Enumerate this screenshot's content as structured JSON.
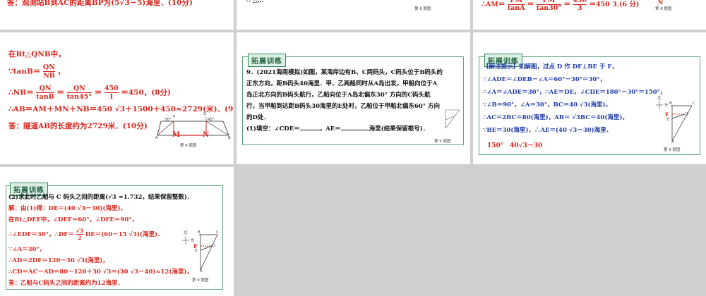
{
  "slide1": {
    "answer": "答：观测站B到AC的距离BP为(5√3－5)海里．(10分)"
  },
  "slide2": {
    "top_text": "∴ △…",
    "caption": "第 8 题图"
  },
  "slide3": {
    "formula": "∴AM＝PM/tanA＝PM/tan30°＝45√3/3＝450√3.(6 分)",
    "formula_left": "∴AM＝",
    "frac1_num": "PM",
    "frac1_den": "tanA",
    "eq": "＝",
    "frac2_num": "PM",
    "frac2_den": "tan30°",
    "frac3_num": "450",
    "frac3_den": "3",
    "formula_right": "＝450 3.(6 分)",
    "caption": "第 8 题图"
  },
  "slide4": {
    "l1": "在Rt△QNB中，",
    "l2_a": "∵tanB＝",
    "l2_num": "QN",
    "l2_den": "NB",
    "l2_b": "，",
    "l3_a": "∴NB＝",
    "l3_f1n": "QN",
    "l3_f1d": "tanB",
    "l3_eq": "＝",
    "l3_f2n": "QN",
    "l3_f2d": "tan45°",
    "l3_eq2": "＝",
    "l3_f3n": "450",
    "l3_f3d": "1",
    "l3_b": "＝450，(8分)",
    "l4": "∴AB＝AM＋MN＋NB＝450 √3＋1500＋450≈2729(米)．(9分)",
    "l5": "答：隧道AB的长度约为2729米．(10分)",
    "fig_labels": [
      "30°",
      "P",
      "Q",
      "45°",
      "A",
      "M",
      "N",
      "B"
    ],
    "caption": "第 8 题图"
  },
  "slide5": {
    "tag": "拓展训练",
    "l1": "9．(2021海南模拟)如图，某海岸边有B、C两码头，C码头位于B码头的",
    "l2": "正东方向，距B码头40海里．甲、乙两船同时从A岛出发，甲船向位于A",
    "l3": "岛正北方向的B码头航行，乙船向位于A岛北偏东30° 方向的C码头航",
    "l4": "行，当甲船到达距B码头30海里的E处时，乙船位于甲船北偏东60° 方向",
    "l5": "的D处．",
    "l6_a": "(1)填空：∠CDE＝",
    "l6_b": "，AE＝",
    "l6_c": "海里(结果保留根号)．",
    "caption": "第 9 题图"
  },
  "slide6": {
    "tag": "拓展训练",
    "l1_tip": "【解法提示】",
    "l1": "如解图，过点 D 作 DF⊥BE 于 F，",
    "l2": "∵∠ADE＝∠DEB－∠A＝60°－30°＝30°，",
    "l3": "∴∠A＝∠ADE＝30°，∴AE＝DE，∠CDE＝180°－30°＝150°，",
    "l4": "∵∠B＝90°，∠A＝30°，BC＝40 √3(海里)，",
    "l5": "∴AC＝2BC＝80(海里)，AB＝ √3BC＝40(海里)，",
    "l6": "∵BE＝30(海里)，∴AE＝(40 √3－30)海里．",
    "answer1": "150°",
    "answer2": "40√3－30",
    "fig_labels": [
      "北",
      "东",
      "B",
      "C",
      "F",
      "D",
      "E",
      "A"
    ],
    "caption": "第 9 题图"
  },
  "slide7": {
    "tag": "拓展训练",
    "q": "(2)求此时乙船与 C 码头之间的距离(√3 ≈1.732，结果保留整数)．",
    "l1": "解：由(1)得：DE＝(40 √3－30)(海里)，",
    "l2": "在Rt△DEF中，∠DEF＝60°，∠DFE＝90°，",
    "l3_a": "∴∠EDF＝30°，∴DF＝",
    "l3_num": "√3",
    "l3_den": "2",
    "l3_b": "DE＝(60－15 √3)(海里)．",
    "l4": "∵∠A＝30°，",
    "l5": "∴AD＝2DF＝120－30 √3(海里)，",
    "l6": "∴CD＝AC－AD＝80－120＋30 √3＝(30 √3－40)≈12(海里)，",
    "l7": "答：乙船与C码头之间的距离约为12海里．",
    "fig_labels": [
      "北",
      "东",
      "B",
      "C",
      "F",
      "D",
      "E",
      "A"
    ],
    "caption": "第 9 题图"
  },
  "colors": {
    "answer_red": "#d7261e",
    "tag_green": "#2b8c5a",
    "background_gray": "#cfcfcf"
  }
}
